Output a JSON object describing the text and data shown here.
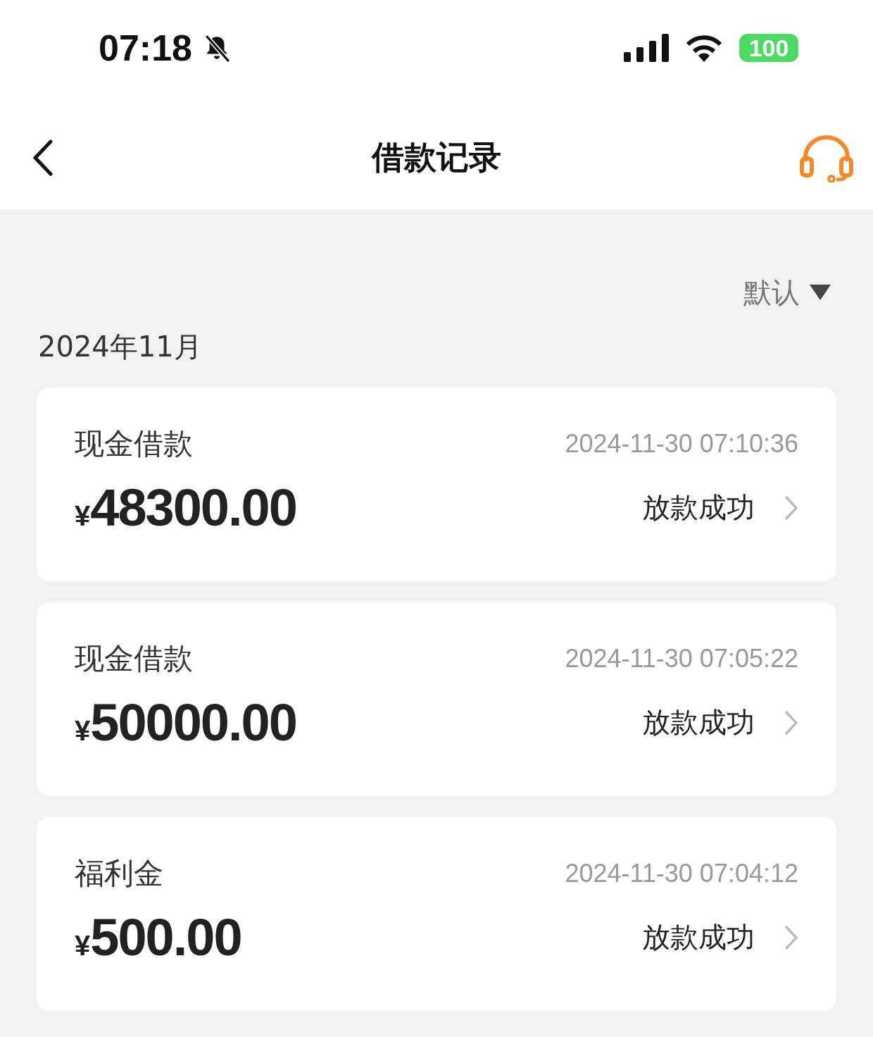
{
  "status_bar": {
    "time": "07:18",
    "battery": "100"
  },
  "nav": {
    "title": "借款记录"
  },
  "sort": {
    "label": "默认"
  },
  "sections": [
    {
      "month": "2024年11月",
      "records": [
        {
          "type": "现金借款",
          "time": "2024-11-30 07:10:36",
          "currency": "¥",
          "amount": "48300.00",
          "status": "放款成功"
        },
        {
          "type": "现金借款",
          "time": "2024-11-30 07:05:22",
          "currency": "¥",
          "amount": "50000.00",
          "status": "放款成功"
        },
        {
          "type": "福利金",
          "time": "2024-11-30 07:04:12",
          "currency": "¥",
          "amount": "500.00",
          "status": "放款成功"
        }
      ]
    }
  ]
}
